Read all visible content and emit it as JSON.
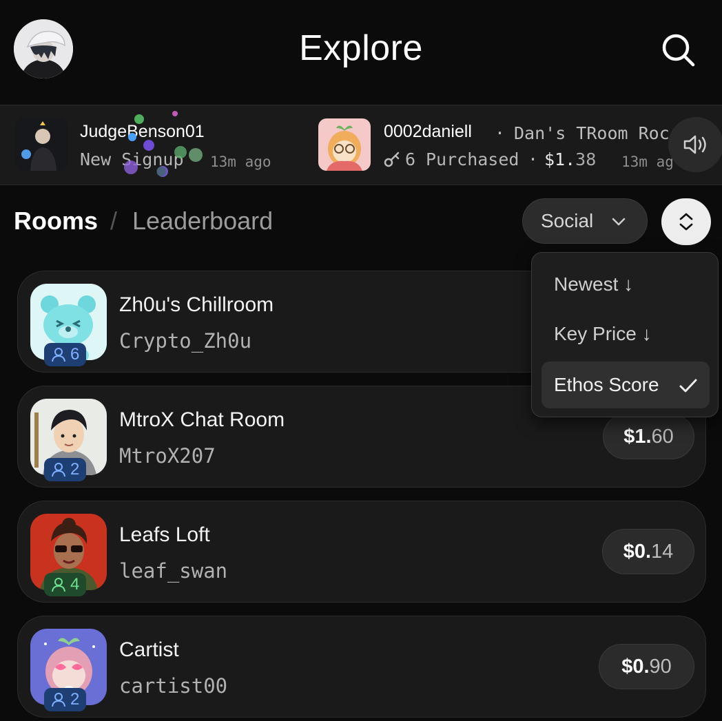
{
  "header": {
    "title": "Explore"
  },
  "ticker": [
    {
      "name": "JudgeBenson01",
      "event": "New Signup",
      "time": "13m ago"
    },
    {
      "name": "0002daniell",
      "room": "Dan's TRoom Roc",
      "keys": "6",
      "action": "Purchased",
      "price_dollar": "$1.",
      "price_cents": "38",
      "time": "13m ag"
    }
  ],
  "nav": {
    "rooms": "Rooms",
    "separator": "/",
    "leaderboard": "Leaderboard"
  },
  "filter": {
    "label": "Social"
  },
  "sort_menu": {
    "options": [
      {
        "label": "Newest ↓",
        "selected": false
      },
      {
        "label": "Key Price ↓",
        "selected": false
      },
      {
        "label": "Ethos Score",
        "selected": true
      }
    ]
  },
  "rooms": [
    {
      "title": "Zh0u's Chillroom",
      "owner": "Crypto_Zh0u",
      "members": "6",
      "badge_color": "#1e3f73",
      "badge_text_color": "#7fb0ff",
      "price_dollar": "",
      "price_cents": ""
    },
    {
      "title": "MtroX Chat Room",
      "owner": "MtroX207",
      "members": "2",
      "badge_color": "#1e3f73",
      "badge_text_color": "#7fb0ff",
      "price_dollar": "$1.",
      "price_cents": "60"
    },
    {
      "title": "Leafs Loft",
      "owner": "leaf_swan",
      "members": "4",
      "badge_color": "#1f4a2c",
      "badge_text_color": "#6ee08f",
      "price_dollar": "$0.",
      "price_cents": "14"
    },
    {
      "title": "Cartist",
      "owner": "cartist00",
      "members": "2",
      "badge_color": "#1e3f73",
      "badge_text_color": "#7fb0ff",
      "price_dollar": "$0.",
      "price_cents": "90"
    }
  ],
  "icons": {
    "avatar": "user-avatar",
    "search": "search-icon",
    "sound": "speaker-icon",
    "chevron": "chevron-down-icon",
    "sort": "sort-icon",
    "check": "check-icon",
    "member": "person-icon",
    "key": "key-icon"
  },
  "colors": {
    "background": "#0b0b0b",
    "card": "#1a1a1a",
    "pill": "#2b2b2b",
    "sort_button": "#eeeeee"
  }
}
